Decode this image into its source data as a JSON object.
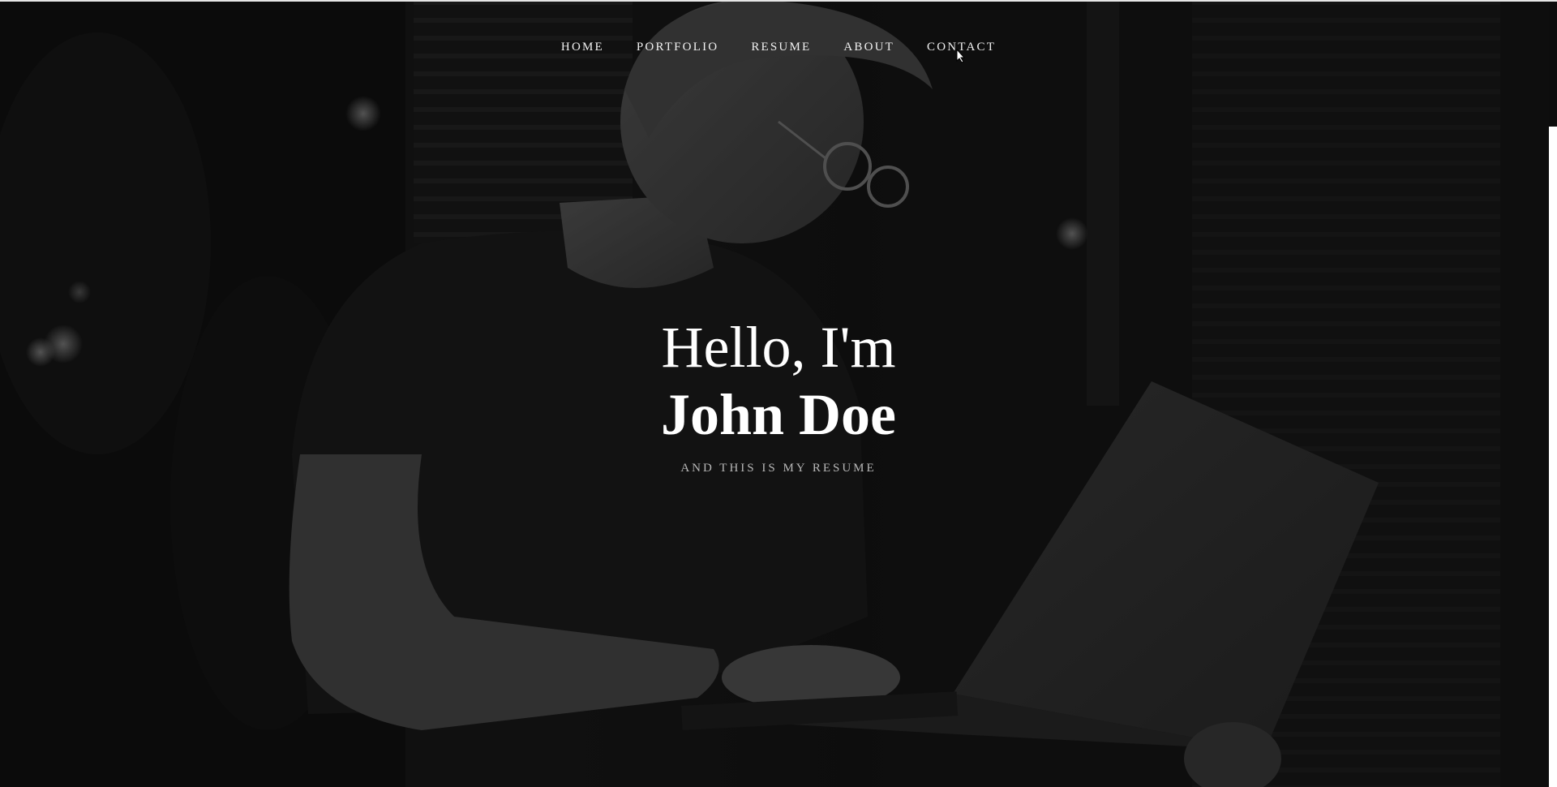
{
  "nav": {
    "items": [
      {
        "label": "HOME"
      },
      {
        "label": "PORTFOLIO"
      },
      {
        "label": "RESUME"
      },
      {
        "label": "ABOUT"
      },
      {
        "label": "CONTACT"
      }
    ]
  },
  "hero": {
    "greeting": "Hello, I'm",
    "name": "John Doe",
    "tagline": "AND THIS IS MY RESUME",
    "background": "grayscale photo of a man with glasses working on a laptop"
  },
  "colors": {
    "text_primary": "#ffffff",
    "text_secondary": "#b8b8b8",
    "background": "#0f0f0f"
  }
}
